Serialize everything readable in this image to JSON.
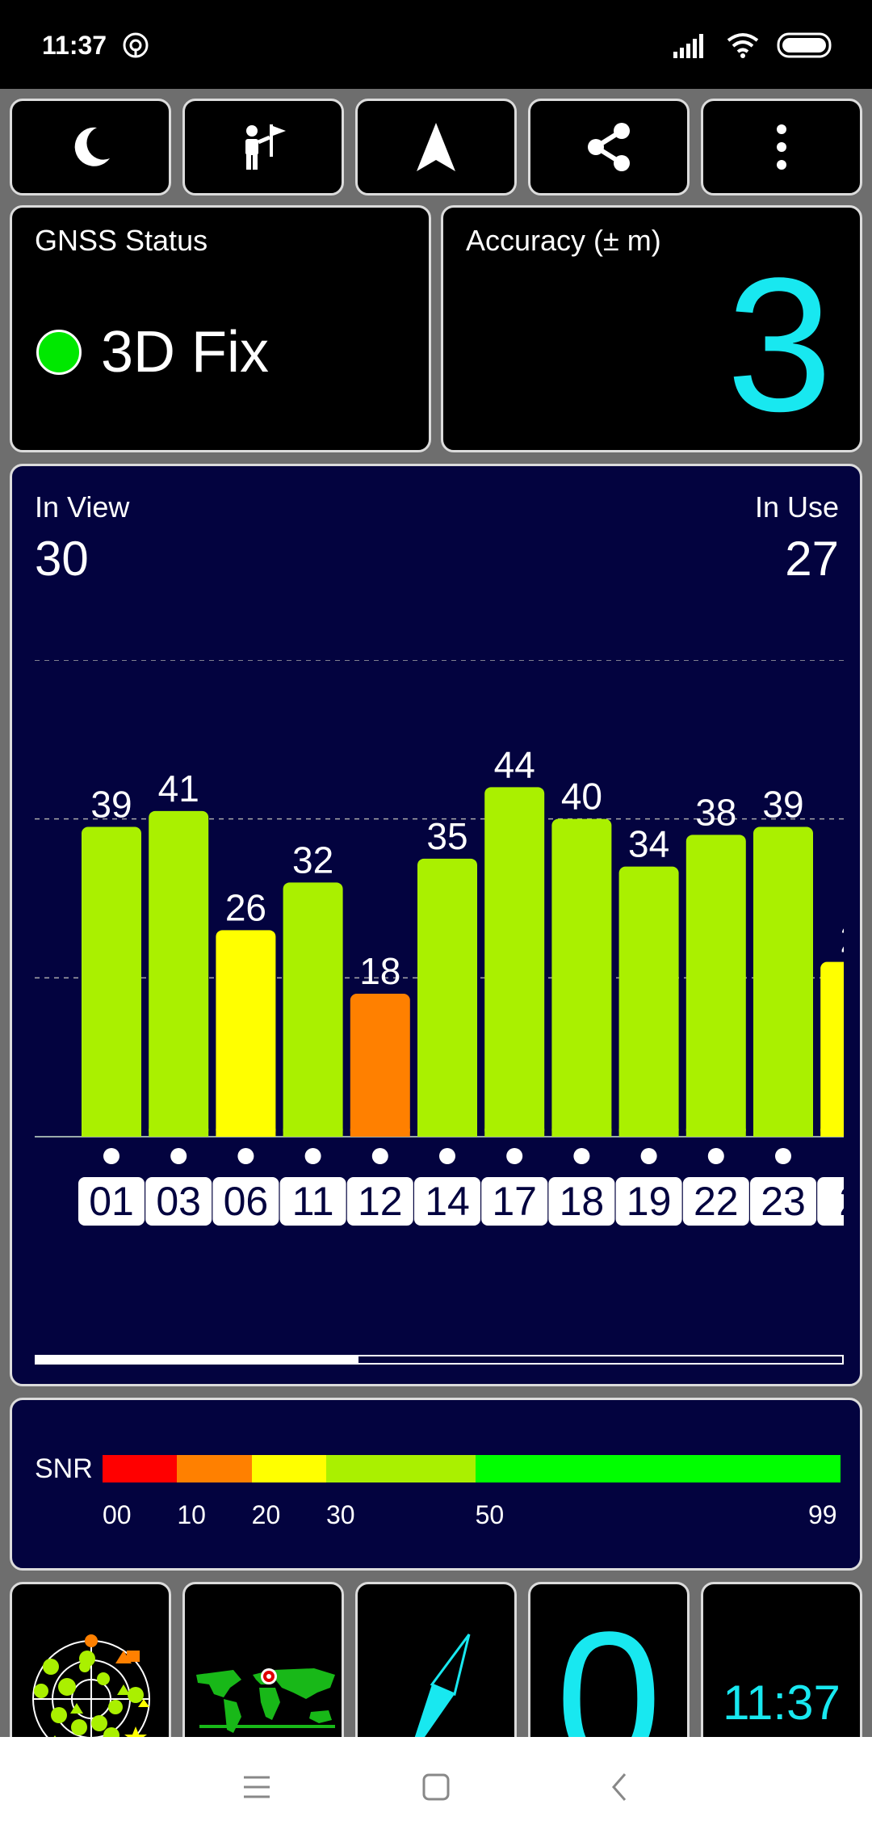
{
  "status_bar": {
    "time": "11:37",
    "icons": [
      "hotspot-icon",
      "signal-icon",
      "wifi-icon",
      "battery-icon"
    ]
  },
  "toolbar": {
    "buttons": [
      "moon-icon",
      "person-flag-icon",
      "navigation-arrow-icon",
      "share-icon",
      "overflow-menu-icon"
    ]
  },
  "gnss_status": {
    "label": "GNSS Status",
    "value": "3D Fix",
    "indicator_color": "#00e800"
  },
  "accuracy": {
    "label": "Accuracy (± m)",
    "value": "3",
    "color": "#18e8f0"
  },
  "satellites": {
    "in_view_label": "In View",
    "in_view": "30",
    "in_use_label": "In Use",
    "in_use": "27",
    "scroll_position": 0.4
  },
  "chart_data": {
    "type": "bar",
    "categories": [
      "01",
      "03",
      "06",
      "11",
      "12",
      "14",
      "17",
      "18",
      "19",
      "22",
      "23",
      "2"
    ],
    "values": [
      39,
      41,
      26,
      32,
      18,
      35,
      44,
      40,
      34,
      38,
      39,
      22
    ],
    "value_labels": [
      "39",
      "41",
      "26",
      "32",
      "18",
      "35",
      "44",
      "40",
      "34",
      "38",
      "39",
      "2"
    ],
    "ylim": [
      0,
      60
    ],
    "gridlines": [
      20,
      40,
      60
    ],
    "used_in_fix": [
      true,
      true,
      true,
      true,
      true,
      true,
      true,
      true,
      true,
      true,
      true,
      false
    ],
    "color_scale": {
      "0": "#ff0000",
      "10": "#ff8000",
      "20": "#ffff00",
      "30": "#aaf000",
      "50": "#00ff00"
    }
  },
  "snr_legend": {
    "label": "SNR",
    "ticks": [
      "00",
      "10",
      "20",
      "30",
      "50",
      "99"
    ],
    "segments": [
      {
        "from": 0,
        "to": 10,
        "color": "#ff0000"
      },
      {
        "from": 10,
        "to": 20,
        "color": "#ff8000"
      },
      {
        "from": 20,
        "to": 30,
        "color": "#ffff00"
      },
      {
        "from": 30,
        "to": 50,
        "color": "#aaf000"
      },
      {
        "from": 50,
        "to": 99,
        "color": "#00ff00"
      }
    ]
  },
  "bottom_bar": {
    "buttons": [
      "sky-radar-icon",
      "world-map-icon",
      "compass-icon",
      "speed-value",
      "clock-value"
    ],
    "speed": "0",
    "clock": "11:37"
  },
  "nav_bar": {
    "icons": [
      "menu-icon",
      "home-icon",
      "back-icon"
    ]
  }
}
